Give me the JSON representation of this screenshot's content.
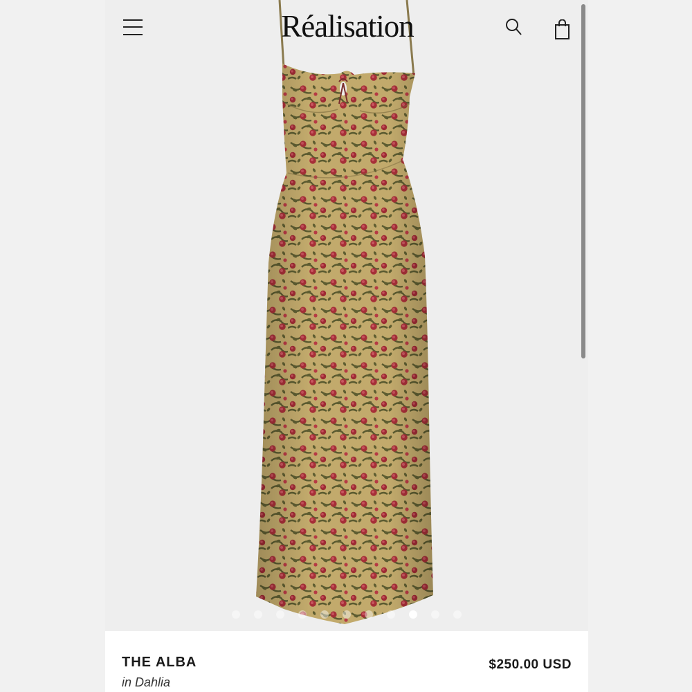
{
  "header": {
    "brand": "Réalisation",
    "menu_icon": "hamburger-menu-icon",
    "search_icon": "search-icon",
    "bag_icon": "shopping-bag-icon"
  },
  "carousel": {
    "total_slides": 11,
    "active_index": 8
  },
  "product": {
    "name": "THE ALBA",
    "color": "in Dahlia",
    "price": "$250.00 USD",
    "image_description": "floral print midi slip dress"
  },
  "colors": {
    "dress_base": "#b9a065",
    "flower_red": "#a8303a",
    "leaf_green": "#55552e",
    "background": "#eeeeee"
  }
}
